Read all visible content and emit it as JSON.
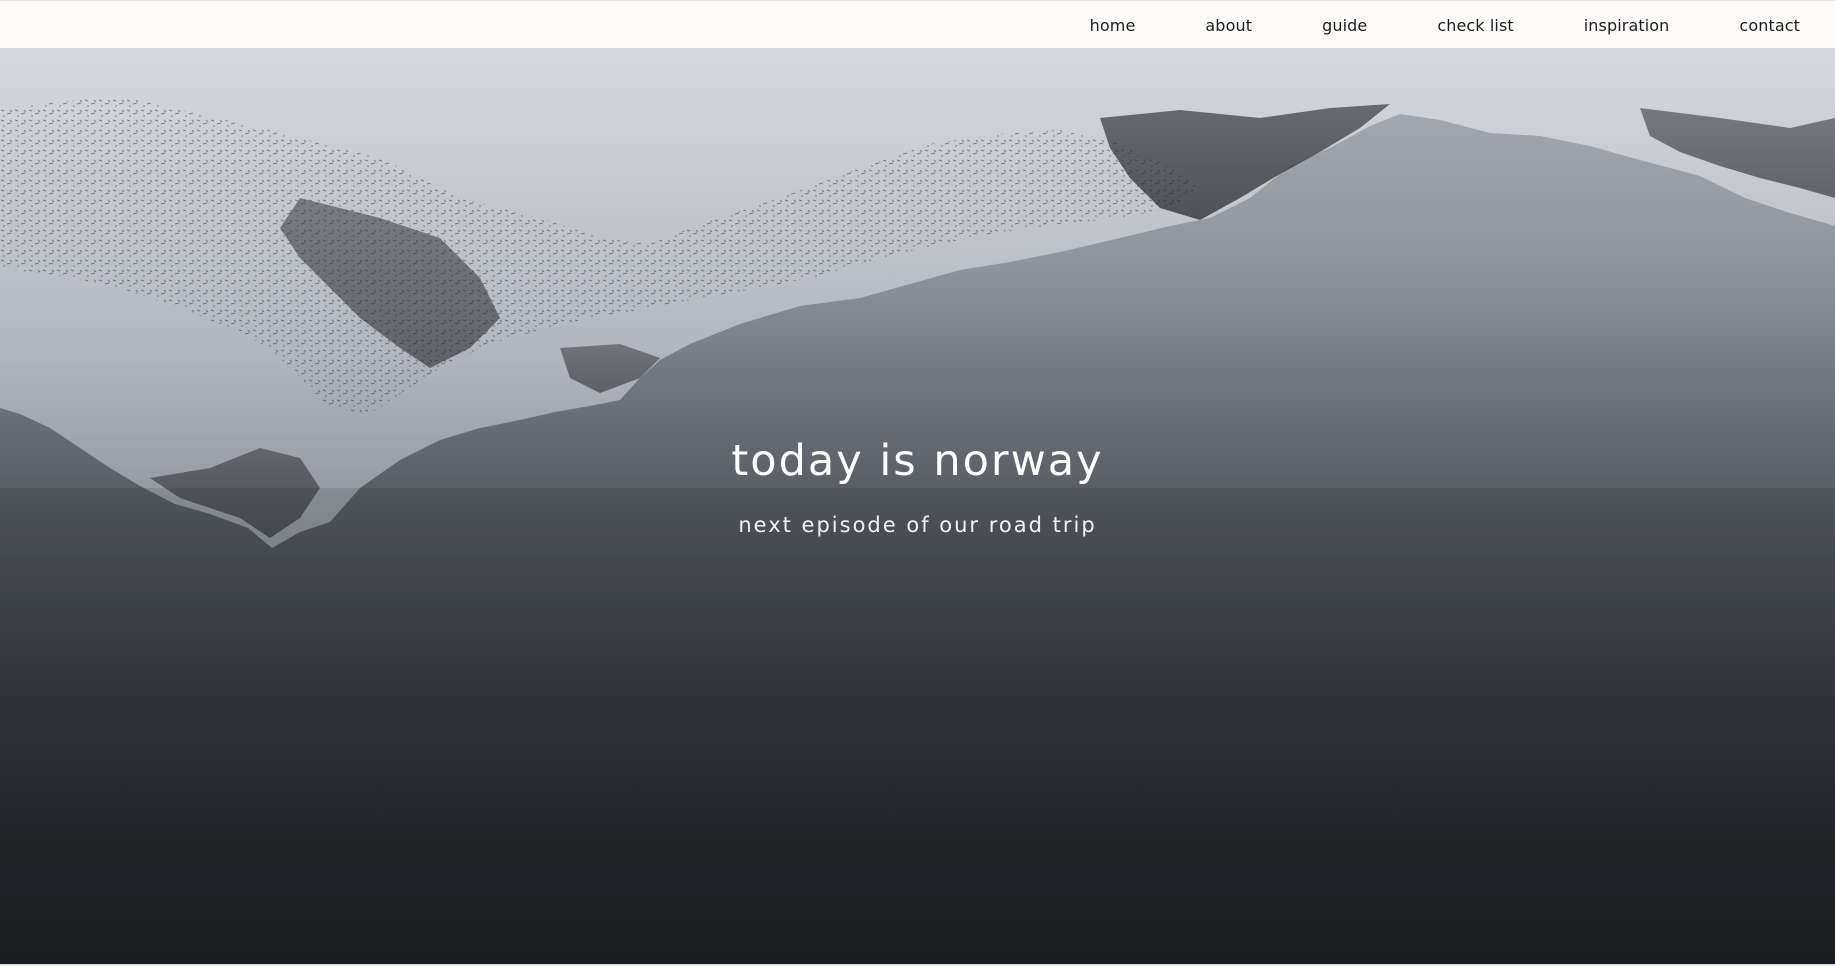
{
  "nav": {
    "items": [
      {
        "label": "home"
      },
      {
        "label": "about"
      },
      {
        "label": "guide"
      },
      {
        "label": "check list"
      },
      {
        "label": "inspiration"
      },
      {
        "label": "contact"
      }
    ]
  },
  "hero": {
    "title": "today is norway",
    "subtitle": "next episode of our road trip",
    "image": "inverted-mountain-reflection-over-lake"
  },
  "colors": {
    "nav_bg": "#fdfbfa",
    "nav_text": "#1d1d1d",
    "hero_text": "#ffffff",
    "hero_top": "#a9aeb8",
    "hero_bottom": "#1d1f22"
  }
}
